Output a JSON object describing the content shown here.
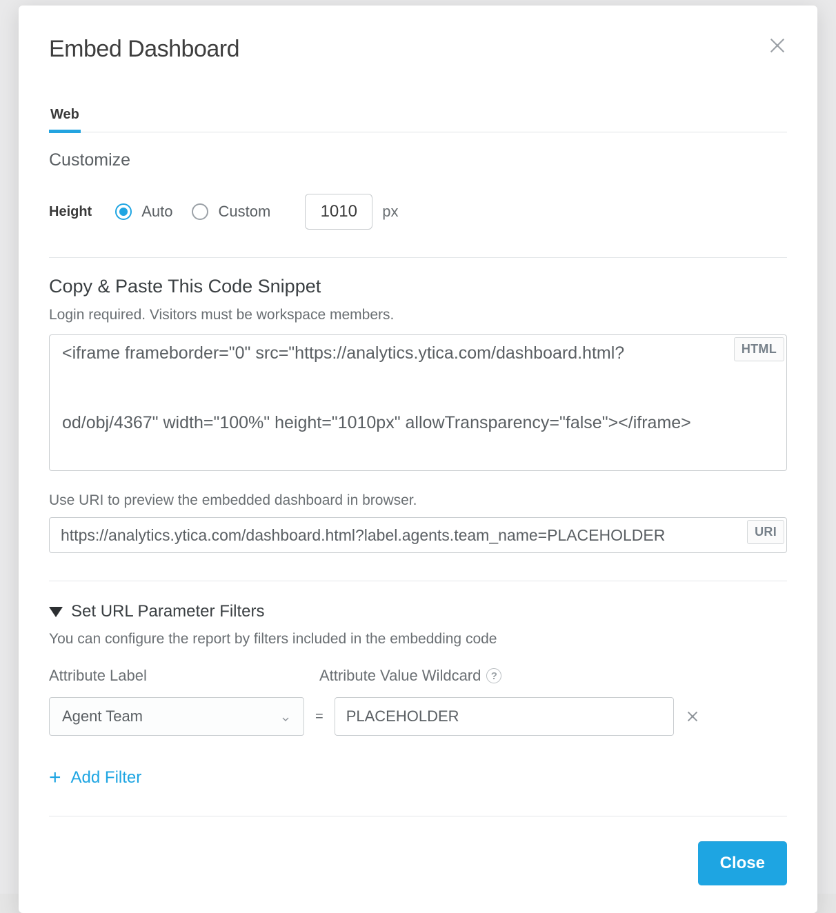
{
  "modal": {
    "title": "Embed Dashboard",
    "tabs": {
      "web": "Web"
    },
    "customize_label": "Customize",
    "height": {
      "label": "Height",
      "auto": "Auto",
      "custom": "Custom",
      "value": "1010",
      "unit": "px"
    },
    "snippet": {
      "title": "Copy & Paste This Code Snippet",
      "subtitle": "Login required. Visitors must be workspace members.",
      "code": "<iframe frameborder=\"0\" src=\"https://analytics.ytica.com/dashboard.html?\n\n\nod/obj/4367\" width=\"100%\" height=\"1010px\" allowTransparency=\"false\"></iframe>",
      "badge": "HTML"
    },
    "uri": {
      "subtitle": "Use URI to preview the embedded dashboard in browser.",
      "value": "https://analytics.ytica.com/dashboard.html?label.agents.team_name=PLACEHOLDER",
      "badge": "URI"
    },
    "filters": {
      "title": "Set URL Parameter Filters",
      "subtitle": "You can configure the report by filters included in the embedding code",
      "col_attr": "Attribute Label",
      "col_val": "Attribute Value Wildcard",
      "attr_value": "Agent Team",
      "val_value": "PLACEHOLDER",
      "add": "Add Filter"
    },
    "close": "Close"
  }
}
